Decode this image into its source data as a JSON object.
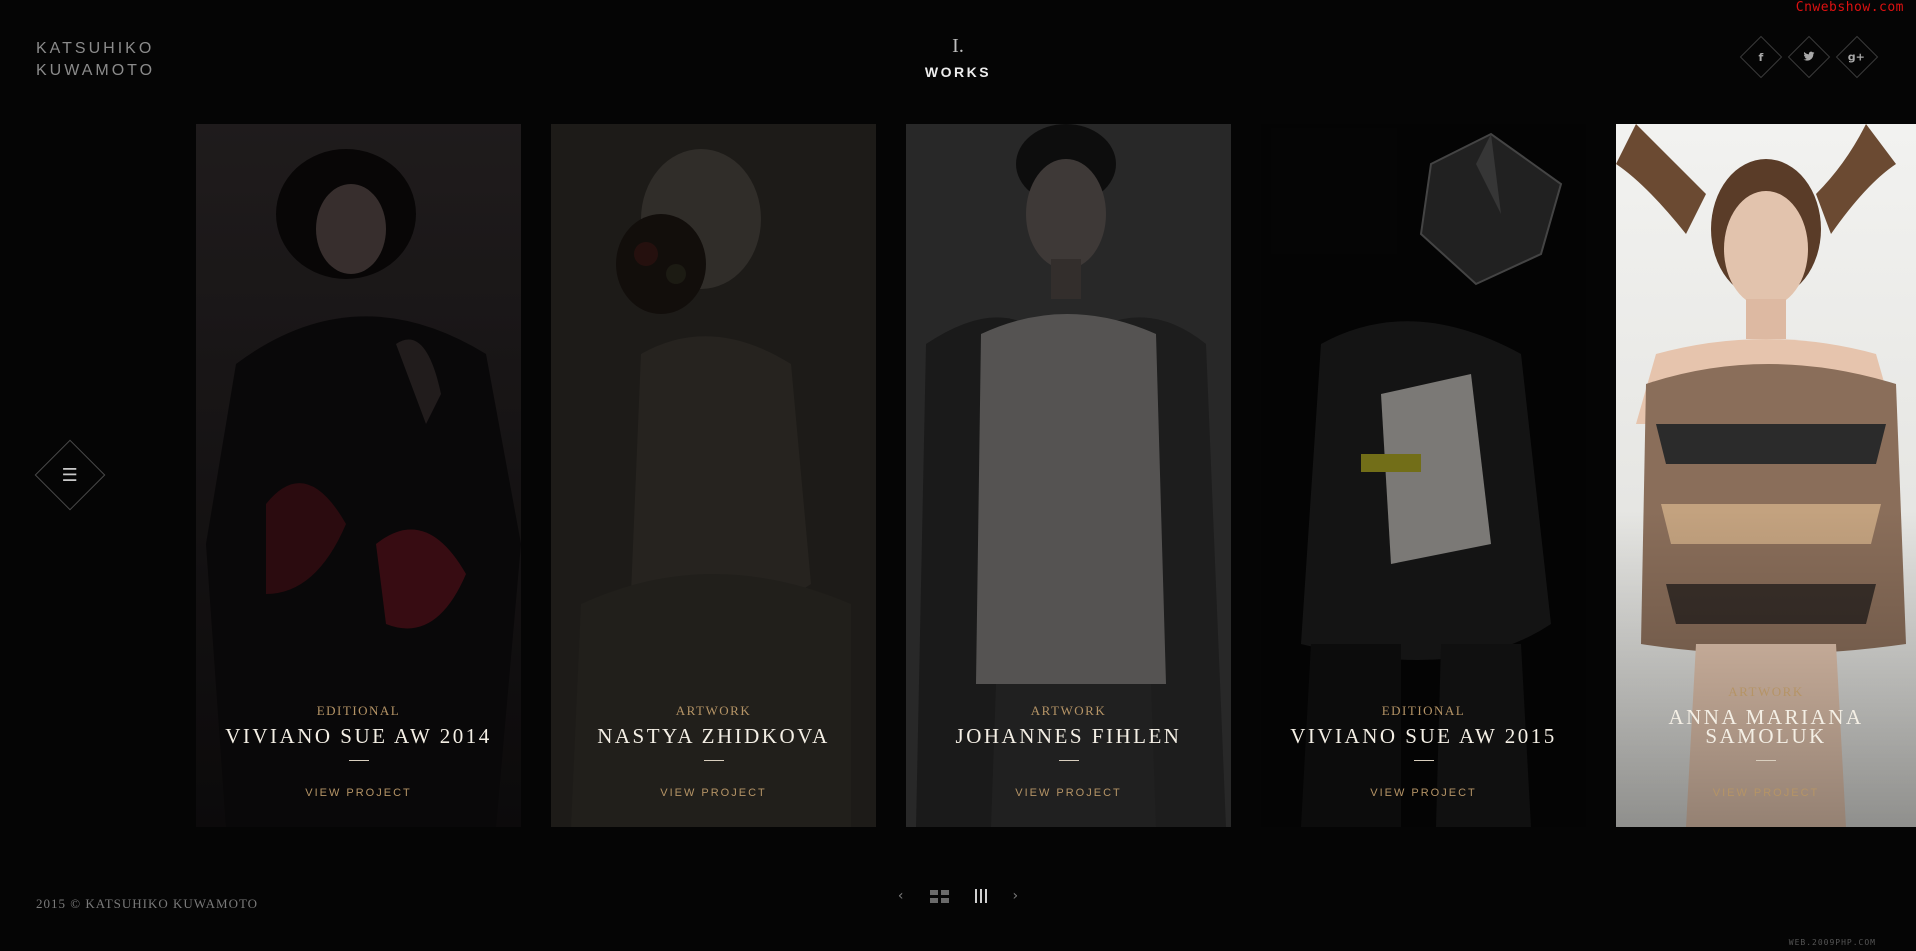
{
  "watermark": "Cnwebshow.com",
  "watermark_bottom": "WEB.2009PHP.COM",
  "brand": {
    "line1": "KATSUHIKO",
    "line2": "KUWAMOTO"
  },
  "section": {
    "numeral": "I.",
    "title": "WORKS"
  },
  "social": [
    {
      "name": "facebook",
      "glyph": "f"
    },
    {
      "name": "twitter",
      "glyph": "t"
    },
    {
      "name": "google-plus",
      "glyph": "g+"
    }
  ],
  "menu": {
    "glyph": "☰"
  },
  "cards": [
    {
      "category": "EDITIONAL",
      "title": "VIVIANO SUE AW 2014",
      "link": "VIEW PROJECT"
    },
    {
      "category": "ARTWORK",
      "title": "NASTYA ZHIDKOVA",
      "link": "VIEW PROJECT"
    },
    {
      "category": "ARTWORK",
      "title": "JOHANNES FIHLEN",
      "link": "VIEW PROJECT"
    },
    {
      "category": "EDITIONAL",
      "title": "VIVIANO SUE AW 2015",
      "link": "VIEW PROJECT"
    },
    {
      "category": "ARTWORK",
      "title": "ANNA MARIANA SAMOLUK",
      "link": "VIEW PROJECT"
    }
  ],
  "footer": {
    "copyright": "2015 © KATSUHIKO KUWAMOTO",
    "prev": "‹",
    "next": "›"
  },
  "colors": {
    "accent": "#b59466",
    "background": "#050505"
  }
}
